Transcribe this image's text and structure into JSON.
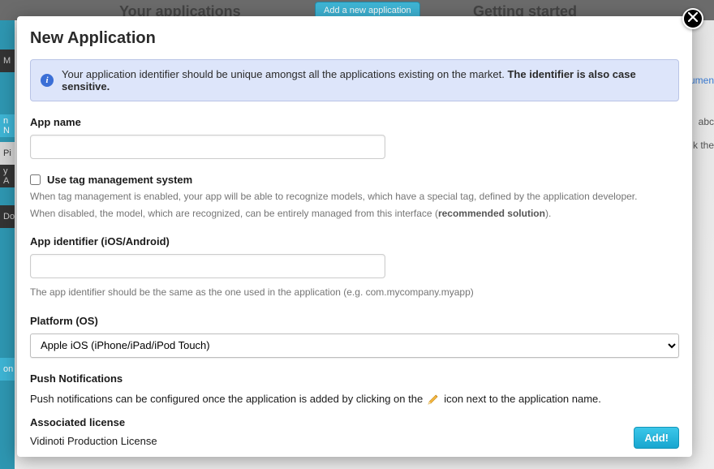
{
  "background": {
    "title_left": "Your applications",
    "add_btn": "Add a new application",
    "title_right": "Getting started",
    "right_link": "umen",
    "right_t1": "abc",
    "right_t2": "k the",
    "side_items": [
      "M",
      "n N",
      "Pi",
      "y A",
      "Do",
      "on"
    ]
  },
  "modal": {
    "title": "New Application",
    "info": {
      "text_plain": "Your application identifier should be unique amongst all the applications existing on the market. ",
      "text_bold": "The identifier is also case sensitive."
    },
    "app_name": {
      "label": "App name",
      "value": ""
    },
    "tag_mgmt": {
      "label": "Use tag management system",
      "help1": "When tag management is enabled, your app will be able to recognize models, which have a special tag, defined by the application developer.",
      "help2_a": "When disabled, the model, which are recognized, can be entirely managed from this interface (",
      "help2_bold": "recommended solution",
      "help2_b": ")."
    },
    "app_id": {
      "label": "App identifier (iOS/Android)",
      "value": "",
      "help": "The app identifier should be the same as the one used in the application (e.g. com.mycompany.myapp)"
    },
    "platform": {
      "label": "Platform (OS)",
      "selected": "Apple iOS (iPhone/iPad/iPod Touch)"
    },
    "push": {
      "label": "Push Notifications",
      "text_a": "Push notifications can be configured once the application is added by clicking on the",
      "text_b": "icon next to the application name."
    },
    "license": {
      "label": "Associated license",
      "value": "Vidinoti Production License"
    },
    "add_btn": "Add!"
  }
}
